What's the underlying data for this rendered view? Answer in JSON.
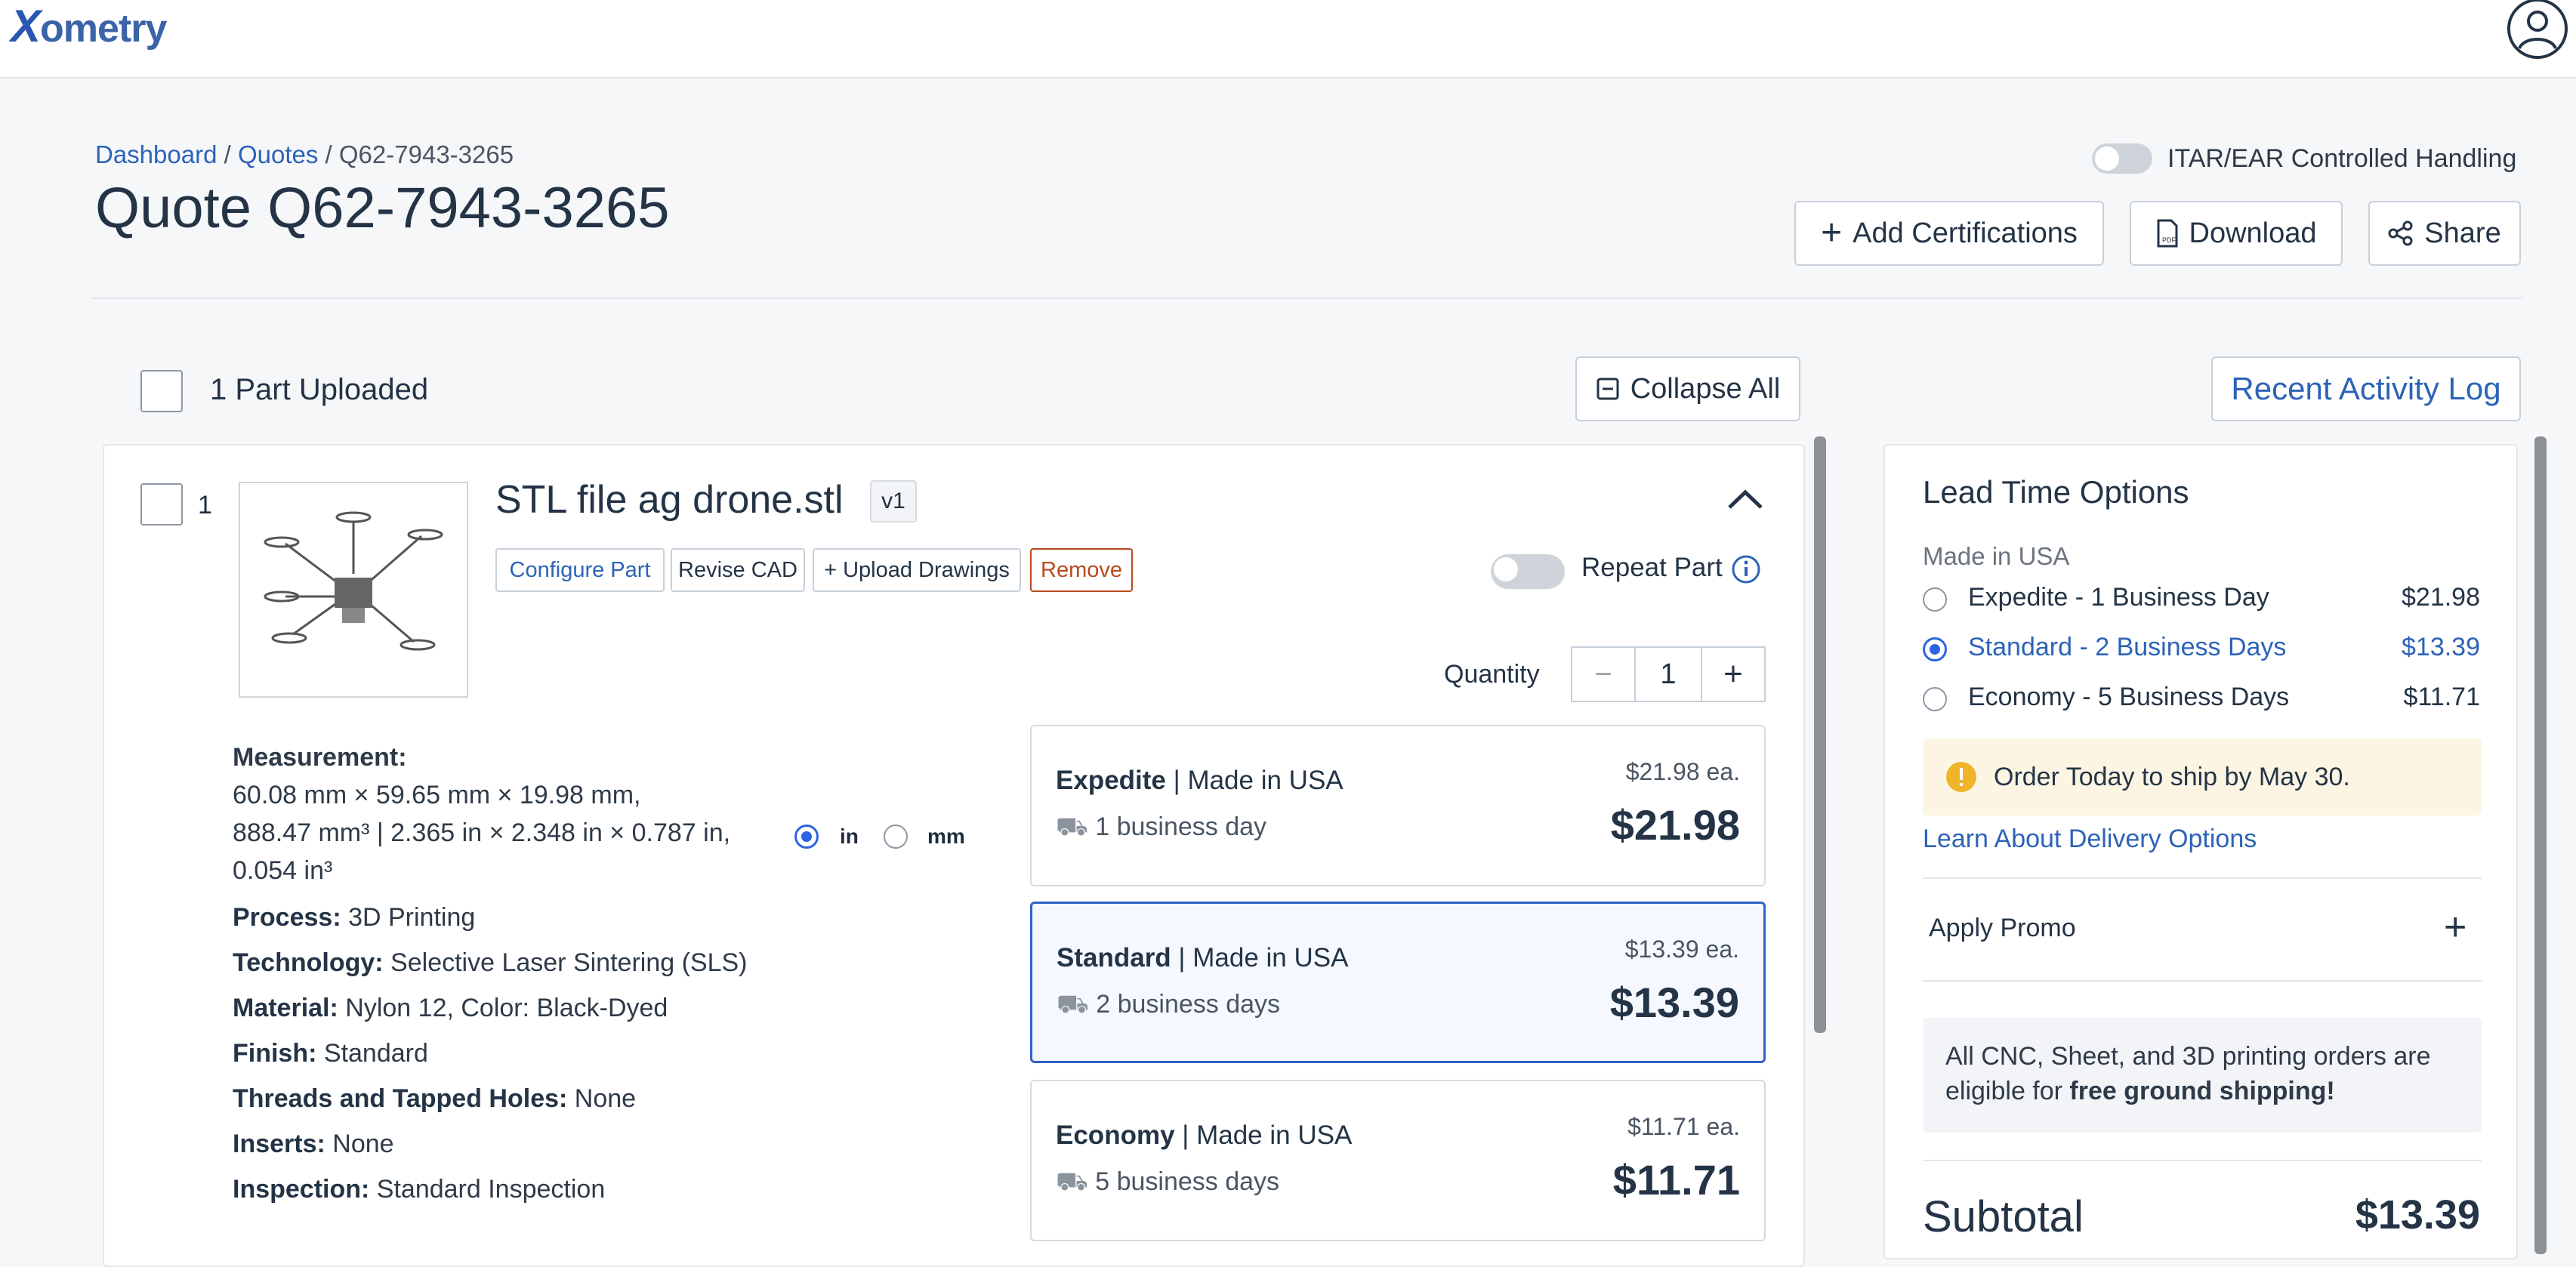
{
  "header": {
    "logo_text": "ometry",
    "logo_x": "X"
  },
  "breadcrumb": {
    "dashboard": "Dashboard",
    "sep1": " / ",
    "quotes": "Quotes",
    "sep2": " / ",
    "current": "Q62-7943-3265"
  },
  "page_title": "Quote Q62-7943-3265",
  "itar_label": "ITAR/EAR Controlled Handling",
  "actions": {
    "add_cert": "Add Certifications",
    "download": "Download",
    "share": "Share"
  },
  "parts_header": {
    "count_label": "1 Part Uploaded",
    "collapse": "Collapse All",
    "activity": "Recent Activity Log"
  },
  "part": {
    "index": "1",
    "name": "STL file ag drone.stl",
    "version": "v1",
    "buttons": {
      "configure": "Configure Part",
      "revise": "Revise CAD",
      "upload": "+ Upload Drawings",
      "remove": "Remove"
    },
    "repeat_label": "Repeat Part",
    "quantity_label": "Quantity",
    "quantity": "1",
    "specs": {
      "measurement_label": "Measurement:",
      "measurement_line1": "60.08 mm × 59.65 mm × 19.98 mm,",
      "measurement_line2": "888.47 mm³  |  2.365 in × 2.348 in × 0.787 in,",
      "measurement_line3": "0.054 in³",
      "unit_in": "in",
      "unit_mm": "mm",
      "process_label": "Process:",
      "process": "3D Printing",
      "tech_label": "Technology:",
      "tech": "Selective Laser Sintering (SLS)",
      "material_label": "Material:",
      "material": "Nylon 12, Color: Black-Dyed",
      "finish_label": "Finish:",
      "finish": "Standard",
      "threads_label": "Threads and Tapped Holes:",
      "threads": "None",
      "inserts_label": "Inserts:",
      "inserts": "None",
      "inspection_label": "Inspection:",
      "inspection": "Standard Inspection"
    },
    "lead_times": [
      {
        "name": "Expedite",
        "origin": "Made in USA",
        "days": "1 business day",
        "each": "$21.98 ea.",
        "price": "$21.98"
      },
      {
        "name": "Standard",
        "origin": "Made in USA",
        "days": "2 business days",
        "each": "$13.39 ea.",
        "price": "$13.39"
      },
      {
        "name": "Economy",
        "origin": "Made in USA",
        "days": "5 business days",
        "each": "$11.71 ea.",
        "price": "$11.71"
      }
    ]
  },
  "sidebar": {
    "title": "Lead Time Options",
    "origin": "Made in USA",
    "options": [
      {
        "label": "Expedite - 1 Business Day",
        "price": "$21.98"
      },
      {
        "label": "Standard - 2 Business Days",
        "price": "$13.39"
      },
      {
        "label": "Economy - 5 Business Days",
        "price": "$11.71"
      }
    ],
    "notice": "Order Today to ship by May 30.",
    "learn_link": "Learn About Delivery Options",
    "promo": "Apply Promo",
    "shipping_text1": "All CNC, Sheet, and 3D printing orders are",
    "shipping_text2": "eligible for ",
    "shipping_bold": "free ground shipping!",
    "subtotal_label": "Subtotal",
    "subtotal": "$13.39"
  },
  "colors": {
    "accent": "#2c63b8",
    "remove": "#b84a1c",
    "notice_bg": "#fdf5e4",
    "warn_icon": "#f0b429"
  }
}
